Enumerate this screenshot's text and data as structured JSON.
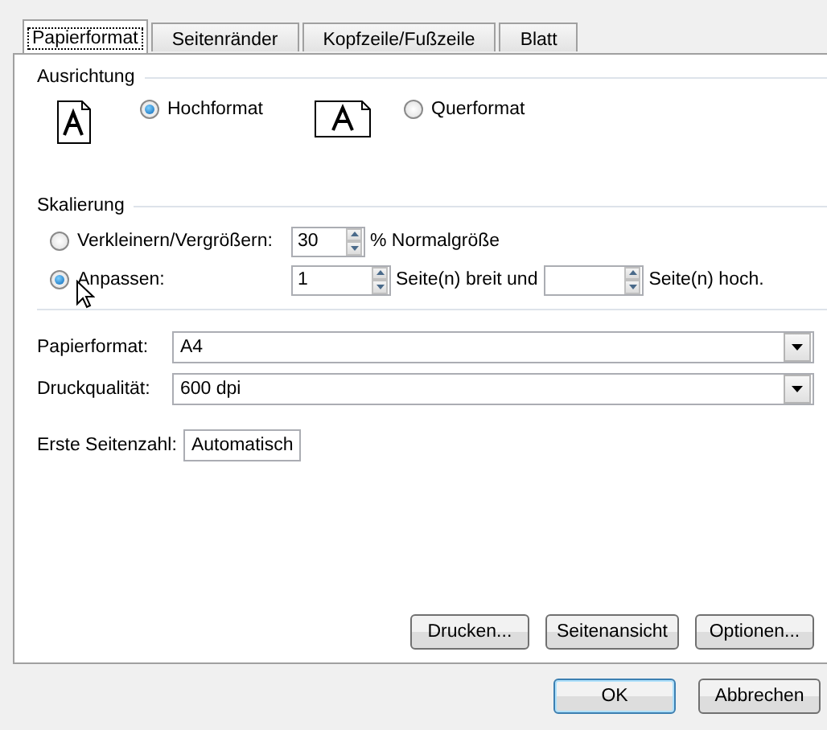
{
  "tabs": [
    {
      "label": "Papierformat",
      "selected": true
    },
    {
      "label": "Seitenränder",
      "selected": false
    },
    {
      "label": "Kopfzeile/Fußzeile",
      "selected": false
    },
    {
      "label": "Blatt",
      "selected": false
    }
  ],
  "orientation": {
    "title": "Ausrichtung",
    "options": [
      {
        "label": "Hochformat",
        "kind": "portrait",
        "selected": true
      },
      {
        "label": "Querformat",
        "kind": "landscape",
        "selected": false
      }
    ]
  },
  "scaling": {
    "title": "Skalierung",
    "options": [
      {
        "label": "Verkleinern/Vergrößern:",
        "selected": false,
        "fields": [
          {
            "value": "30",
            "suffix": "% Normalgröße"
          }
        ]
      },
      {
        "label": "Anpassen:",
        "selected": true,
        "fields": [
          {
            "value": "1",
            "suffix": "Seite(n) breit und"
          },
          {
            "suffix": "Seite(n) hoch."
          }
        ]
      }
    ]
  },
  "dropdowns": [
    {
      "label": "Papierformat:",
      "value": "A4"
    },
    {
      "label": "Druckqualität:",
      "value": "600 dpi"
    }
  ],
  "first_page": {
    "label": "Erste Seitenzahl:",
    "value": "Automatisch"
  },
  "action_buttons": [
    "Drucken...",
    "Seitenansicht",
    "Optionen..."
  ],
  "dialog_buttons": [
    {
      "label": "OK",
      "default": true
    },
    {
      "label": "Abbrechen",
      "default": false
    }
  ]
}
